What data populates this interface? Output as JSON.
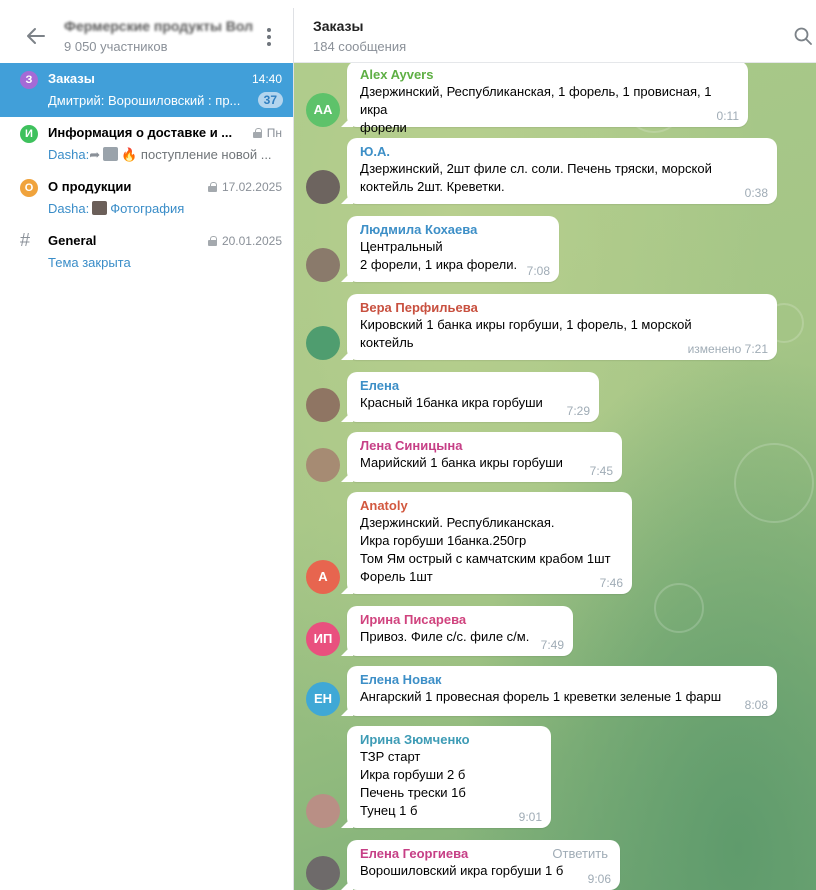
{
  "group": {
    "title": "Фермерские продукты Волгоград",
    "members": "9 050 участников"
  },
  "topics": [
    {
      "initial": "З",
      "color": "#a56ad6",
      "name": "Заказы",
      "time": "14:40",
      "sender": "Дмитрий:",
      "preview": "Ворошиловский : пр...",
      "badge": "37"
    },
    {
      "initial": "И",
      "color": "#3ec15d",
      "name": "Информация о доставке и ...",
      "time": "Пн",
      "sender": "Dasha:",
      "preview": "поступление новой ..."
    },
    {
      "initial": "О",
      "color": "#f0a33c",
      "name": "О продукции",
      "time": "17.02.2025",
      "sender": "Dasha:",
      "preview": "Фотография"
    },
    {
      "initial": "#",
      "name": "General",
      "time": "20.01.2025",
      "preview": "Тема закрыта"
    }
  ],
  "chat": {
    "title": "Заказы",
    "subtitle": "184 сообщения",
    "reply_label": "Ответить"
  },
  "messages": [
    {
      "name": "Alex Ayvers",
      "name_color": "#5eaf44",
      "avatar": "AA",
      "avatar_color": "#5ec26a",
      "lines": [
        "Дзержинский, Республиканская, 1 форель, 1 провисная, 1 икра",
        "форели"
      ],
      "time": "0:11"
    },
    {
      "name": "Ю.А.",
      "name_color": "#3d8fc7",
      "avatar": "",
      "avatar_color": "#6d645f",
      "lines": [
        "Дзержинский,  2шт филе сл. соли. Печень тряски, морской",
        "коктейль 2шт. Креветки."
      ],
      "time": "0:38"
    },
    {
      "name": "Людмила Кохаева",
      "name_color": "#3d8fc7",
      "avatar": "",
      "avatar_color": "#8a7a6b",
      "lines": [
        "Центральный",
        "2 форели, 1 икра форели."
      ],
      "time": "7:08"
    },
    {
      "name": "Вера Перфильева",
      "name_color": "#c8503f",
      "avatar": "",
      "avatar_color": "#4f9d6f",
      "lines": [
        "Кировский 1 банка икры горбуши, 1 форель, 1 морской",
        "коктейль"
      ],
      "time": "изменено 7:21"
    },
    {
      "name": "Елена",
      "name_color": "#3d8fc7",
      "avatar": "",
      "avatar_color": "#8f7563",
      "lines": [
        "Красный 1банка икра горбуши"
      ],
      "time": "7:29"
    },
    {
      "name": "Лена Синицына",
      "name_color": "#c63f86",
      "avatar": "",
      "avatar_color": "#a68b73",
      "lines": [
        "Марийский 1 банка икры горбуши"
      ],
      "time": "7:45"
    },
    {
      "name": "Anatoly",
      "name_color": "#d2583f",
      "avatar": "A",
      "avatar_color": "#e7654f",
      "lines": [
        "Дзержинский. Республиканская.",
        "Икра горбуши 1банка.250гр",
        "Том Ям острый с камчатским крабом 1шт",
        "Форель 1шт"
      ],
      "time": "7:46"
    },
    {
      "name": "Ирина Писарева",
      "name_color": "#d0437e",
      "avatar": "ИП",
      "avatar_color": "#e9507e",
      "lines": [
        "Привоз. Филе с/с. филе с/м."
      ],
      "time": "7:49"
    },
    {
      "name": "Елена Новак",
      "name_color": "#3d8fc7",
      "avatar": "ЕН",
      "avatar_color": "#3fa8d6",
      "lines": [
        "Ангарский 1  провесная форель 1 креветки зеленые 1 фарш"
      ],
      "time": "8:08"
    },
    {
      "name": "Ирина Зюмченко",
      "name_color": "#3d9bb5",
      "avatar": "",
      "avatar_color": "#b98f85",
      "lines": [
        "ТЗР старт",
        "Икра горбуши 2 б",
        "Печень трески 1б",
        "Тунец 1 б"
      ],
      "time": "9:01"
    },
    {
      "name": "Елена Георгиева",
      "name_color": "#c63f86",
      "avatar": "",
      "avatar_color": "#6e6a6a",
      "lines": [
        "Ворошиловский икра горбуши 1 б"
      ],
      "time": "9:06"
    }
  ]
}
